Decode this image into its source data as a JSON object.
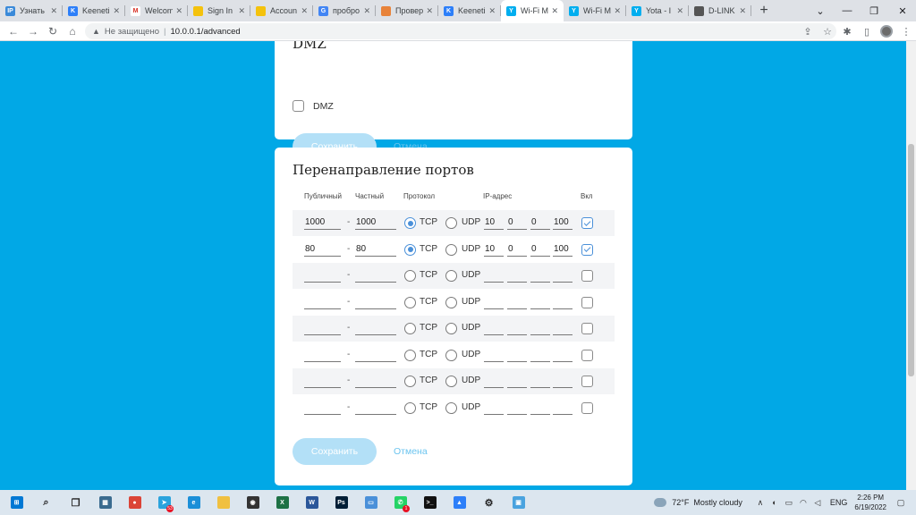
{
  "browser": {
    "tabs": [
      {
        "title": "Узнать",
        "fav_color": "#3b8ad9",
        "fav_glyph": "IP",
        "active": false
      },
      {
        "title": "Keeneti",
        "fav_color": "#2d7ff9",
        "fav_glyph": "K",
        "active": false
      },
      {
        "title": "Welcom",
        "fav_color": "#ffffff",
        "fav_glyph": "M",
        "active": false
      },
      {
        "title": "Sign In",
        "fav_color": "#f4c20d",
        "fav_glyph": "",
        "active": false
      },
      {
        "title": "Accoun",
        "fav_color": "#f4c20d",
        "fav_glyph": "",
        "active": false
      },
      {
        "title": "пробро",
        "fav_color": "#4285f4",
        "fav_glyph": "G",
        "active": false
      },
      {
        "title": "Провер",
        "fav_color": "#e8833a",
        "fav_glyph": "",
        "active": false
      },
      {
        "title": "Keeneti",
        "fav_color": "#2d7ff9",
        "fav_glyph": "K",
        "active": false
      },
      {
        "title": "Wi-Fi M",
        "fav_color": "#00aeef",
        "fav_glyph": "Y",
        "active": true
      },
      {
        "title": "Wi-Fi M",
        "fav_color": "#00aeef",
        "fav_glyph": "Y",
        "active": false
      },
      {
        "title": "Yota - I",
        "fav_color": "#00aeef",
        "fav_glyph": "Y",
        "active": false
      },
      {
        "title": "D-LINK",
        "fav_color": "#555555",
        "fav_glyph": "",
        "active": false
      }
    ],
    "security_label": "Не защищено",
    "url": "10.0.0.1/advanced"
  },
  "dmz": {
    "title": "DMZ",
    "checkbox_label": "DMZ",
    "checked": false,
    "save_label": "Сохранить",
    "cancel_label": "Отмена"
  },
  "port_forwarding": {
    "title": "Перенаправление портов",
    "headers": {
      "public": "Публичный",
      "private": "Частный",
      "protocol": "Протокол",
      "ip": "IP-адрес",
      "enabled": "Вкл"
    },
    "tcp_label": "TCP",
    "udp_label": "UDP",
    "dash": "-",
    "rows": [
      {
        "public": "1000",
        "private": "1000",
        "protocol": "TCP",
        "ip": [
          "10",
          "0",
          "0",
          "100"
        ],
        "enabled": true
      },
      {
        "public": "80",
        "private": "80",
        "protocol": "TCP",
        "ip": [
          "10",
          "0",
          "0",
          "100"
        ],
        "enabled": true
      },
      {
        "public": "",
        "private": "",
        "protocol": "",
        "ip": [
          "",
          "",
          "",
          ""
        ],
        "enabled": false
      },
      {
        "public": "",
        "private": "",
        "protocol": "",
        "ip": [
          "",
          "",
          "",
          ""
        ],
        "enabled": false
      },
      {
        "public": "",
        "private": "",
        "protocol": "",
        "ip": [
          "",
          "",
          "",
          ""
        ],
        "enabled": false
      },
      {
        "public": "",
        "private": "",
        "protocol": "",
        "ip": [
          "",
          "",
          "",
          ""
        ],
        "enabled": false
      },
      {
        "public": "",
        "private": "",
        "protocol": "",
        "ip": [
          "",
          "",
          "",
          ""
        ],
        "enabled": false
      },
      {
        "public": "",
        "private": "",
        "protocol": "",
        "ip": [
          "",
          "",
          "",
          ""
        ],
        "enabled": false
      }
    ],
    "save_label": "Сохранить",
    "cancel_label": "Отмена"
  },
  "taskbar": {
    "apps": [
      {
        "name": "start-icon",
        "color": "#0078d4",
        "glyph": "⊞"
      },
      {
        "name": "search-icon",
        "color": "#dce6ef",
        "glyph": "⌕"
      },
      {
        "name": "task-view-icon",
        "color": "#dce6ef",
        "glyph": "❐"
      },
      {
        "name": "calculator-icon",
        "color": "#3a6b8f",
        "glyph": "▦"
      },
      {
        "name": "chrome-icon",
        "color": "#db4437",
        "glyph": "●"
      },
      {
        "name": "telegram-icon",
        "color": "#2aa3dd",
        "glyph": "➤"
      },
      {
        "name": "edge-icon",
        "color": "#1b8fd8",
        "glyph": "e"
      },
      {
        "name": "folder-icon",
        "color": "#f0c040",
        "glyph": ""
      },
      {
        "name": "camera-icon",
        "color": "#333333",
        "glyph": "◉"
      },
      {
        "name": "excel-icon",
        "color": "#1e7145",
        "glyph": "X"
      },
      {
        "name": "word-icon",
        "color": "#2b579a",
        "glyph": "W"
      },
      {
        "name": "photoshop-icon",
        "color": "#001e36",
        "glyph": "Ps"
      },
      {
        "name": "device-icon",
        "color": "#4a90d9",
        "glyph": "▭"
      },
      {
        "name": "whatsapp-icon",
        "color": "#25d366",
        "glyph": "✆"
      },
      {
        "name": "terminal-icon",
        "color": "#111111",
        "glyph": ">_"
      },
      {
        "name": "photos-icon",
        "color": "#2d7ff9",
        "glyph": "▲"
      },
      {
        "name": "settings-icon",
        "color": "#dce6ef",
        "glyph": "⚙"
      },
      {
        "name": "remote-desktop-icon",
        "color": "#4aa3df",
        "glyph": "▣"
      }
    ],
    "telegram_badge": "53",
    "whatsapp_badge": "1",
    "weather_temp": "72°F",
    "weather_text": "Mostly cloudy",
    "lang": "ENG",
    "time": "2:26 PM",
    "date": "6/19/2022"
  }
}
